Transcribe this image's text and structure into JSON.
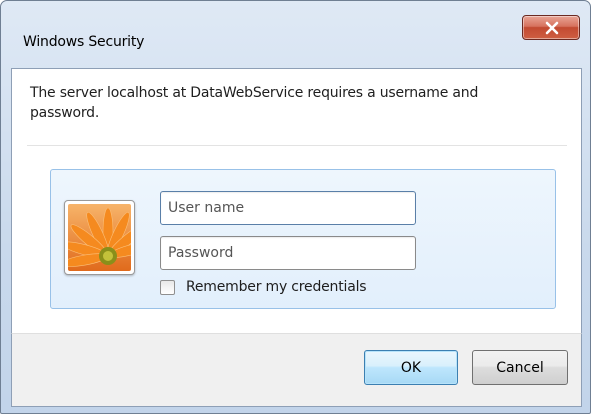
{
  "window": {
    "title": "Windows Security",
    "close_icon": "close-icon"
  },
  "message": "The server localhost at DataWebService requires a username and password.",
  "credentials": {
    "avatar_icon": "user-tile-flower-icon",
    "username": {
      "value": "",
      "placeholder": "User name"
    },
    "password": {
      "value": "",
      "placeholder": "Password"
    },
    "remember": {
      "label": "Remember my credentials",
      "checked": false
    }
  },
  "buttons": {
    "ok_label": "OK",
    "cancel_label": "Cancel"
  },
  "colors": {
    "title_bar": "#c9d9ec",
    "close_button": "#c24a31",
    "tile_background": "#e2effc",
    "tile_border": "#98c1e8",
    "ok_button_border": "#3c7fb1"
  }
}
